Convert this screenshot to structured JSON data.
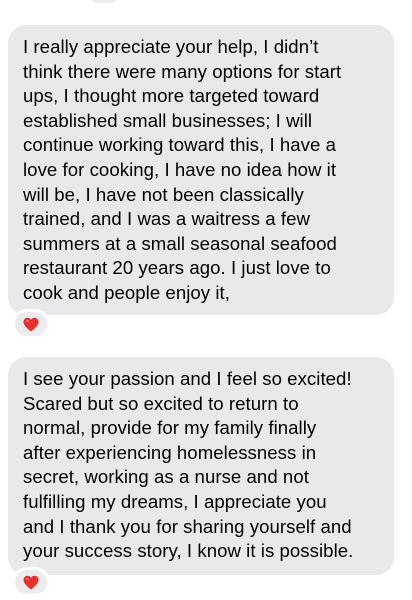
{
  "messages": [
    {
      "text": "I really appreciate your help, I didn’t\nthink there were many options for start\nups, I thought more targeted toward\nestablished small businesses; I will\ncontinue working toward this, I have a\nlove for cooking, I have no idea how it\nwill be, I have not been classically\ntrained, and I was a waitress a few\nsummers at a small seasonal seafood\nrestaurant 20 years ago.  I just love to\ncook and people enjoy it,",
      "reaction": "heart-reaction"
    },
    {
      "text": "I see your passion and I feel so excited!\nScared but so excited to  return to\nnormal, provide for my family finally\nafter experiencing homelessness in\nsecret, working as a nurse and not\nfulfilling my dreams, I appreciate you\nand I thank you for sharing yourself and\nyour success story, I know it is possible.",
      "reaction": "heart-reaction"
    }
  ],
  "colors": {
    "bubble": "#e9e9eb",
    "heart": "#e8302d"
  }
}
